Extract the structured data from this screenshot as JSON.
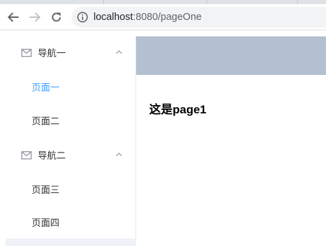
{
  "browser": {
    "url_host": "localhost",
    "url_path": ":8080/pageOne"
  },
  "sidebar": {
    "groups": [
      {
        "title": "导航一",
        "icon": "mail-icon",
        "items": [
          {
            "label": "页面一",
            "active": true
          },
          {
            "label": "页面二",
            "active": false
          }
        ]
      },
      {
        "title": "导航二",
        "icon": "mail-icon",
        "items": [
          {
            "label": "页面三",
            "active": false
          },
          {
            "label": "页面四",
            "active": false
          }
        ]
      }
    ]
  },
  "main": {
    "heading": "这是page1"
  },
  "colors": {
    "active": "#409eff",
    "header_bg": "#b3c0d1",
    "text": "#303133"
  }
}
